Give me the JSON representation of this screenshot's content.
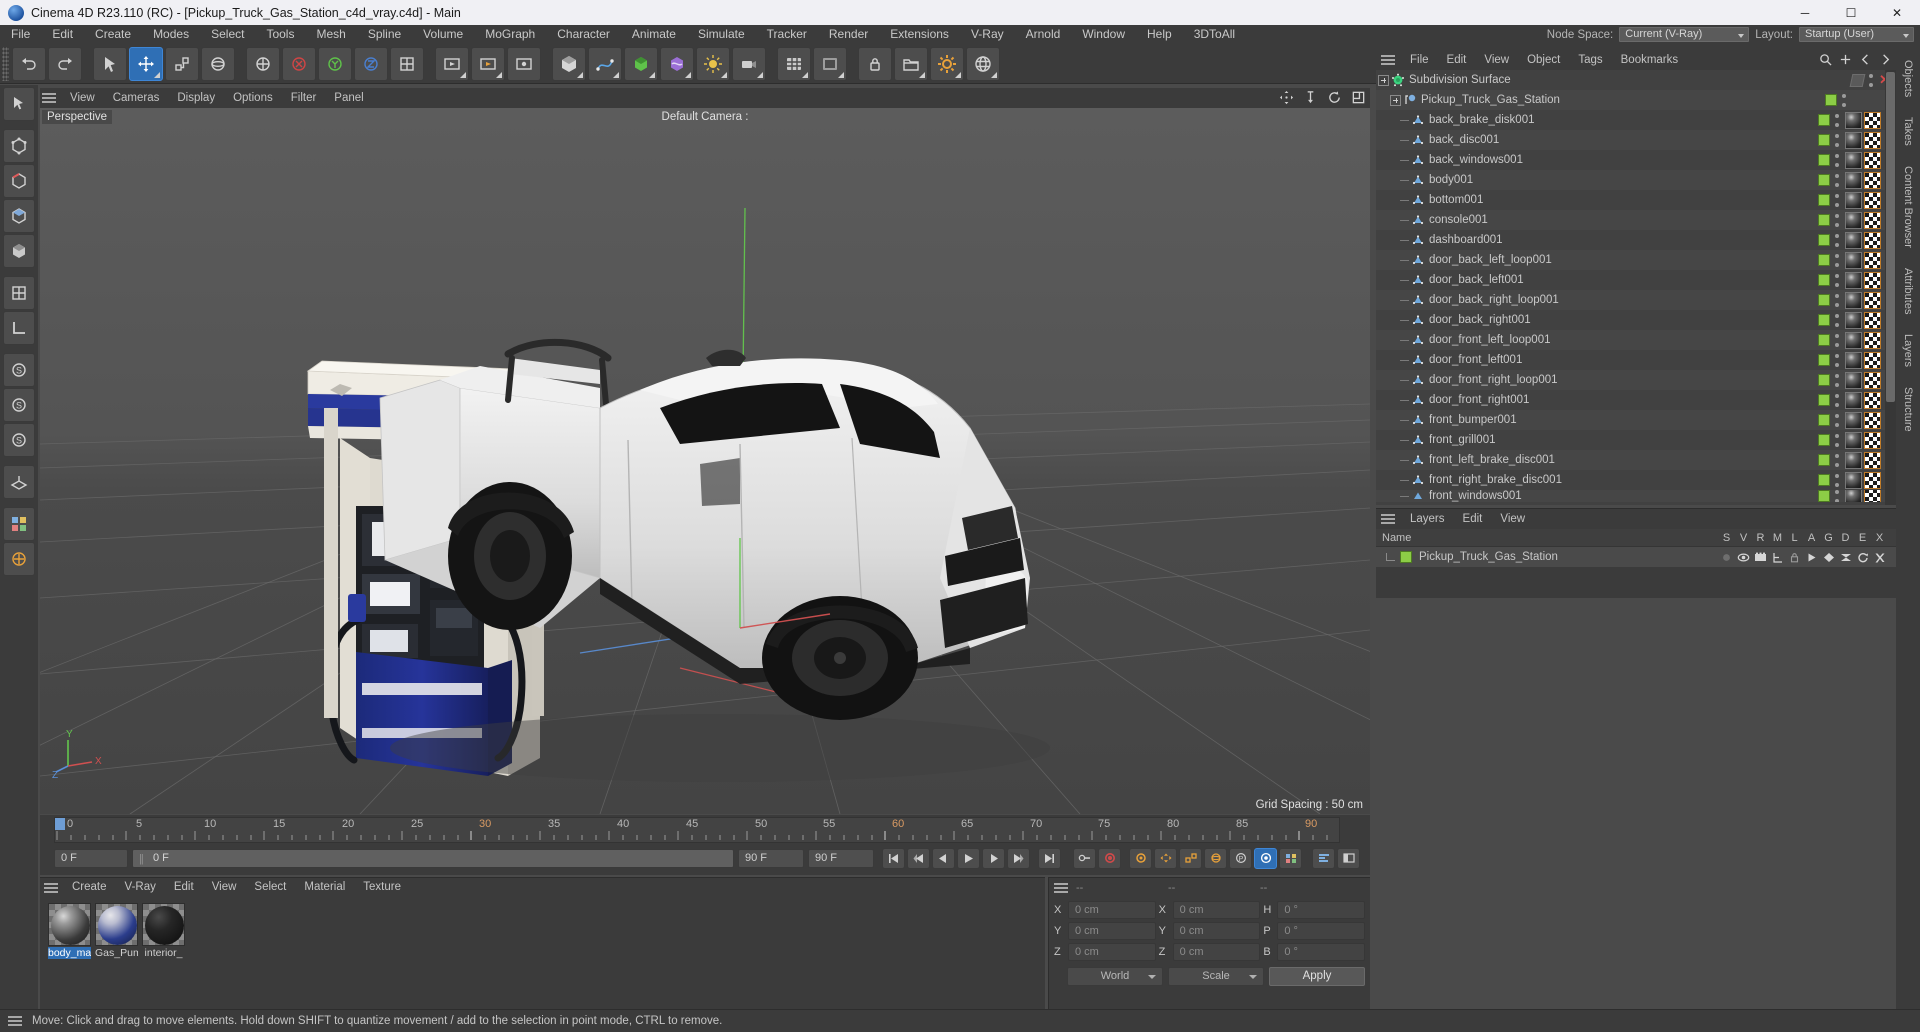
{
  "titlebar": {
    "text": "Cinema 4D R23.110 (RC) - [Pickup_Truck_Gas_Station_c4d_vray.c4d] - Main",
    "minimize": "─",
    "maximize": "☐",
    "close": "✕"
  },
  "menubar": {
    "items": [
      "File",
      "Edit",
      "Create",
      "Modes",
      "Select",
      "Tools",
      "Mesh",
      "Spline",
      "Volume",
      "MoGraph",
      "Character",
      "Animate",
      "Simulate",
      "Tracker",
      "Render",
      "Extensions",
      "V-Ray",
      "Arnold",
      "Window",
      "Help",
      "3DToAll"
    ],
    "node_space_label": "Node Space:",
    "node_space_value": "Current (V-Ray)",
    "layout_label": "Layout:",
    "layout_value": "Startup (User)"
  },
  "viewport": {
    "menu": [
      "View",
      "Cameras",
      "Display",
      "Options",
      "Filter",
      "Panel"
    ],
    "perspective_label": "Perspective",
    "camera_label": "Default Camera :",
    "grid_spacing": "Grid Spacing : 50 cm",
    "axis_x": "X",
    "axis_y": "Y",
    "axis_z": "Z"
  },
  "timeline": {
    "ticks": [
      {
        "label": "0",
        "pos": 0
      },
      {
        "label": "5",
        "pos": 5
      },
      {
        "label": "10",
        "pos": 10
      },
      {
        "label": "15",
        "pos": 15
      },
      {
        "label": "20",
        "pos": 20
      },
      {
        "label": "25",
        "pos": 25
      },
      {
        "label": "30",
        "pos": 30
      },
      {
        "label": "35",
        "pos": 35
      },
      {
        "label": "40",
        "pos": 40
      },
      {
        "label": "45",
        "pos": 45
      },
      {
        "label": "50",
        "pos": 50
      },
      {
        "label": "55",
        "pos": 55
      },
      {
        "label": "60",
        "pos": 60
      },
      {
        "label": "65",
        "pos": 65
      },
      {
        "label": "70",
        "pos": 70
      },
      {
        "label": "75",
        "pos": 75
      },
      {
        "label": "80",
        "pos": 80
      },
      {
        "label": "85",
        "pos": 85
      },
      {
        "label": "90",
        "pos": 90
      }
    ],
    "current_frame_top": "0 F",
    "current_frame": "0 F",
    "scrub_value": "0 F",
    "range_end": "90 F",
    "range_end2": "90 F"
  },
  "material_manager": {
    "menu": [
      "Create",
      "V-Ray",
      "Edit",
      "View",
      "Select",
      "Material",
      "Texture"
    ],
    "materials": [
      {
        "name": "body_ma",
        "kind": "body",
        "selected": true
      },
      {
        "name": "Gas_Pum",
        "kind": "gas",
        "selected": false
      },
      {
        "name": "interior_",
        "kind": "interior",
        "selected": false
      }
    ]
  },
  "coordinates": {
    "header_dashes": [
      "--",
      "--",
      "--"
    ],
    "position_rows": [
      {
        "label": "X",
        "value": "0 cm"
      },
      {
        "label": "Y",
        "value": "0 cm"
      },
      {
        "label": "Z",
        "value": "0 cm"
      }
    ],
    "size_rows": [
      {
        "label": "X",
        "value": "0 cm"
      },
      {
        "label": "Y",
        "value": "0 cm"
      },
      {
        "label": "Z",
        "value": "0 cm"
      }
    ],
    "rotation_rows": [
      {
        "label": "H",
        "value": "0 °"
      },
      {
        "label": "P",
        "value": "0 °"
      },
      {
        "label": "B",
        "value": "0 °"
      }
    ],
    "coord_system": "World",
    "transform_mode": "Scale",
    "apply_label": "Apply"
  },
  "object_manager": {
    "menu": [
      "File",
      "Edit",
      "View",
      "Object",
      "Tags",
      "Bookmarks"
    ],
    "rows": [
      {
        "label": "Subdivision Surface",
        "icon": "subdivision",
        "depth": 0,
        "green": false,
        "tags": []
      },
      {
        "label": "Pickup_Truck_Gas_Station",
        "icon": "null",
        "depth": 1,
        "green": true,
        "tags": []
      },
      {
        "label": "back_brake_disk001",
        "icon": "polygon",
        "depth": 2,
        "green": true,
        "tags": [
          "mat",
          "uv",
          "dot"
        ]
      },
      {
        "label": "back_disc001",
        "icon": "polygon",
        "depth": 2,
        "green": true,
        "tags": [
          "mat",
          "uv",
          "dot"
        ]
      },
      {
        "label": "back_windows001",
        "icon": "polygon",
        "depth": 2,
        "green": true,
        "tags": [
          "mat",
          "uv",
          "dot"
        ]
      },
      {
        "label": "body001",
        "icon": "polygon",
        "depth": 2,
        "green": true,
        "tags": [
          "mat",
          "uv",
          "dot"
        ]
      },
      {
        "label": "bottom001",
        "icon": "polygon",
        "depth": 2,
        "green": true,
        "tags": [
          "mat",
          "uv",
          "dot"
        ]
      },
      {
        "label": "console001",
        "icon": "polygon",
        "depth": 2,
        "green": true,
        "tags": [
          "mat",
          "uv",
          "dot"
        ]
      },
      {
        "label": "dashboard001",
        "icon": "polygon",
        "depth": 2,
        "green": true,
        "tags": [
          "mat",
          "uv",
          "dot"
        ]
      },
      {
        "label": "door_back_left_loop001",
        "icon": "polygon",
        "depth": 2,
        "green": true,
        "tags": [
          "mat",
          "uv",
          "dot"
        ]
      },
      {
        "label": "door_back_left001",
        "icon": "polygon",
        "depth": 2,
        "green": true,
        "tags": [
          "mat",
          "uv",
          "dot"
        ]
      },
      {
        "label": "door_back_right_loop001",
        "icon": "polygon",
        "depth": 2,
        "green": true,
        "tags": [
          "mat",
          "uv",
          "dot"
        ]
      },
      {
        "label": "door_back_right001",
        "icon": "polygon",
        "depth": 2,
        "green": true,
        "tags": [
          "mat",
          "uv",
          "dot"
        ]
      },
      {
        "label": "door_front_left_loop001",
        "icon": "polygon",
        "depth": 2,
        "green": true,
        "tags": [
          "mat",
          "uv",
          "dot"
        ]
      },
      {
        "label": "door_front_left001",
        "icon": "polygon",
        "depth": 2,
        "green": true,
        "tags": [
          "mat",
          "uv",
          "dot"
        ]
      },
      {
        "label": "door_front_right_loop001",
        "icon": "polygon",
        "depth": 2,
        "green": true,
        "tags": [
          "mat",
          "uv",
          "dot"
        ]
      },
      {
        "label": "door_front_right001",
        "icon": "polygon",
        "depth": 2,
        "green": true,
        "tags": [
          "mat",
          "uv",
          "dot"
        ]
      },
      {
        "label": "front_bumper001",
        "icon": "polygon",
        "depth": 2,
        "green": true,
        "tags": [
          "mat",
          "uv",
          "dot"
        ]
      },
      {
        "label": "front_grill001",
        "icon": "polygon",
        "depth": 2,
        "green": true,
        "tags": [
          "mat",
          "uv",
          "dot"
        ]
      },
      {
        "label": "front_left_brake_disc001",
        "icon": "polygon",
        "depth": 2,
        "green": true,
        "tags": [
          "mat",
          "uv",
          "dot"
        ]
      },
      {
        "label": "front_right_brake_disc001",
        "icon": "polygon",
        "depth": 2,
        "green": true,
        "tags": [
          "mat",
          "uv",
          "dot"
        ]
      },
      {
        "label": "front_windows001",
        "icon": "polygon",
        "depth": 2,
        "green": true,
        "tags": [
          "mat",
          "uv",
          "dot"
        ]
      }
    ]
  },
  "layers_panel": {
    "menu": [
      "Layers",
      "Edit",
      "View"
    ],
    "columns": [
      "S",
      "V",
      "R",
      "M",
      "L",
      "A",
      "G",
      "D",
      "E",
      "X"
    ],
    "name_column": "Name",
    "rows": [
      {
        "name": "Pickup_Truck_Gas_Station",
        "color": "#8ccd46"
      }
    ]
  },
  "right_tabs": [
    "Objects",
    "Takes",
    "Content Browser",
    "Attributes",
    "Layers",
    "Structure"
  ],
  "statusbar": {
    "text": "Move: Click and drag to move elements. Hold down SHIFT to quantize movement / add to the selection in point mode, CTRL to remove."
  },
  "colors": {
    "panel_bg": "#3b3b3b",
    "viewport_bg": "#505050",
    "accent_blue": "#2f6fb5",
    "layer_green": "#8ccd46",
    "axis_x": "#d04545",
    "axis_y": "#5fc24a",
    "axis_z": "#4a7fd0"
  }
}
